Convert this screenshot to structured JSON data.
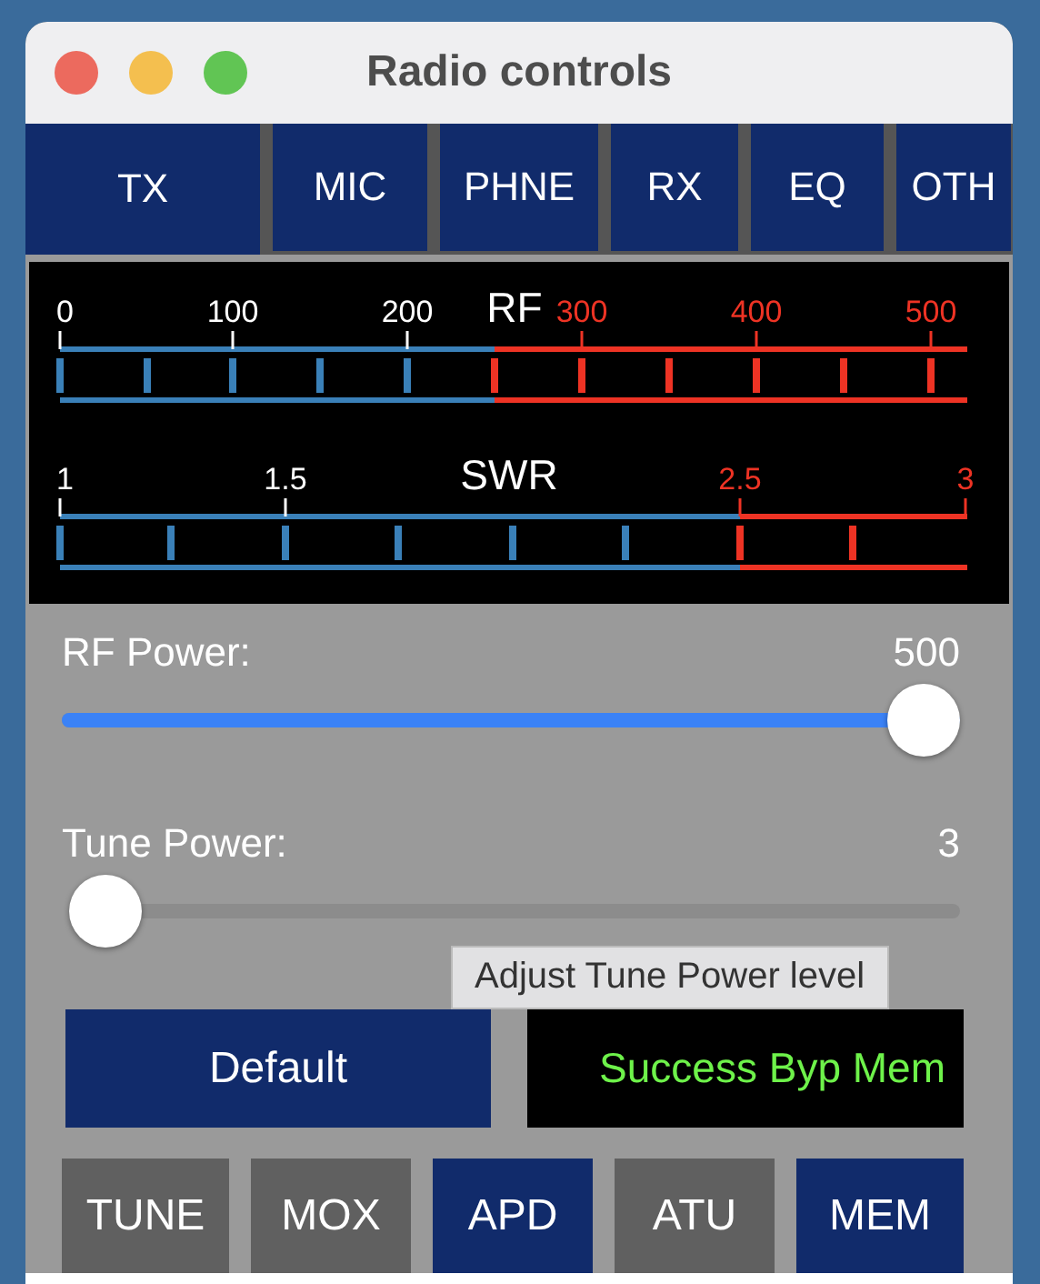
{
  "window": {
    "title": "Radio controls"
  },
  "tabs": [
    {
      "label": "TX",
      "selected": true
    },
    {
      "label": "MIC",
      "selected": false
    },
    {
      "label": "PHNE",
      "selected": false
    },
    {
      "label": "RX",
      "selected": false
    },
    {
      "label": "EQ",
      "selected": false
    },
    {
      "label": "OTH",
      "selected": false
    }
  ],
  "meters": [
    {
      "title": "RF",
      "labels": [
        {
          "text": "0",
          "color": "#ffffff"
        },
        {
          "text": "100",
          "color": "#ffffff"
        },
        {
          "text": "200",
          "color": "#ffffff"
        },
        {
          "text": "300",
          "color": "#ee3324"
        },
        {
          "text": "400",
          "color": "#ee3324"
        },
        {
          "text": "500",
          "color": "#ee3324"
        }
      ]
    },
    {
      "title": "SWR",
      "labels": [
        {
          "text": "1",
          "color": "#ffffff"
        },
        {
          "text": "1.5",
          "color": "#ffffff"
        },
        {
          "text": "2.5",
          "color": "#ee3324"
        },
        {
          "text": "3",
          "color": "#ee3324"
        }
      ]
    }
  ],
  "sliders": [
    {
      "label": "RF Power:",
      "reading": "500",
      "level": 1.0
    },
    {
      "label": "Tune Power:",
      "reading": "3",
      "level": 0.0
    }
  ],
  "tooltip": "Adjust Tune Power level",
  "default_button": "Default",
  "status": "Success Byp Mem",
  "toggles": [
    {
      "label": "TUNE",
      "on": false
    },
    {
      "label": "MOX",
      "on": false
    },
    {
      "label": "APD",
      "on": true
    },
    {
      "label": "ATU",
      "on": false
    },
    {
      "label": "MEM",
      "on": true
    }
  ]
}
